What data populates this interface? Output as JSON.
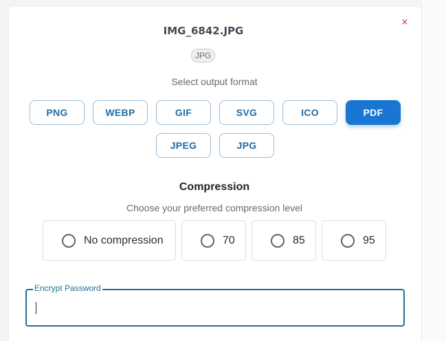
{
  "dialog": {
    "filename": "IMG_6842.JPG",
    "source_badge": "JPG",
    "close_label": "×"
  },
  "formats": {
    "prompt": "Select output format",
    "options": [
      "PNG",
      "WEBP",
      "GIF",
      "SVG",
      "ICO",
      "PDF",
      "JPEG",
      "JPG"
    ],
    "selected": "PDF"
  },
  "compression": {
    "title": "Compression",
    "subtitle": "Choose your preferred compression level",
    "options": [
      "No compression",
      "70",
      "85",
      "95"
    ]
  },
  "password": {
    "label": "Encrypt Password",
    "value": ""
  },
  "colors": {
    "accent": "#1976d2",
    "button_text": "#1e6ea8",
    "field_border": "#1f6f95",
    "close": "#d32f2f"
  }
}
